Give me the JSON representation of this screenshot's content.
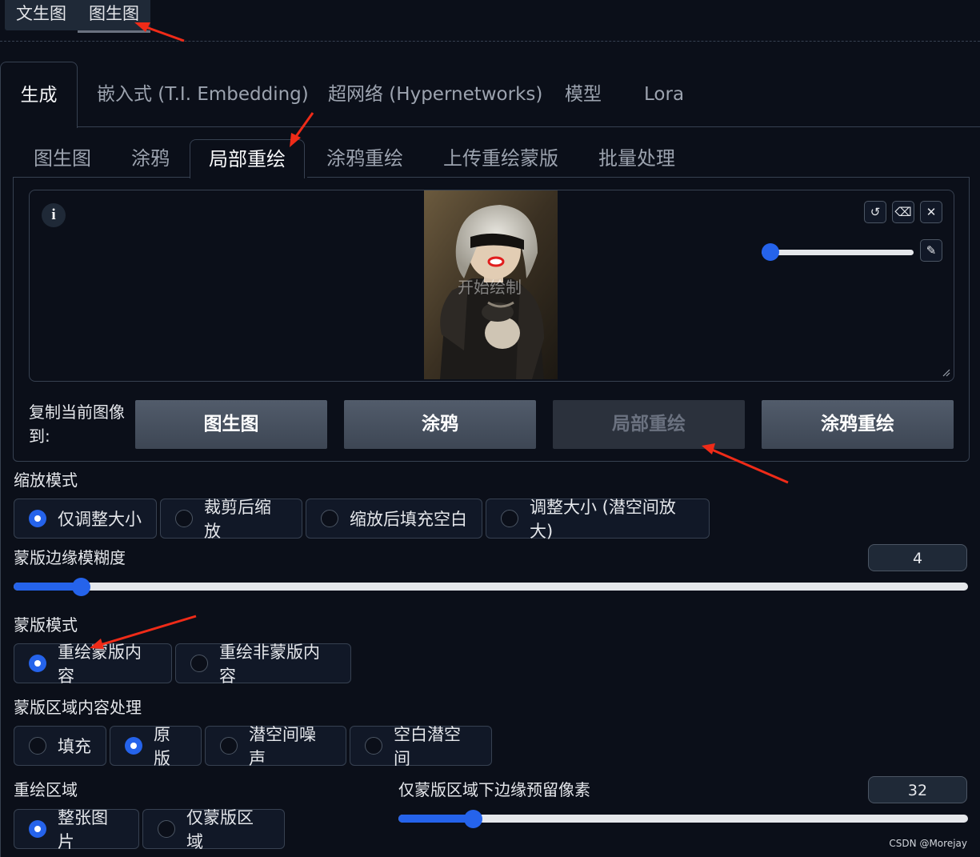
{
  "top_tabs": [
    "文生图",
    "图生图"
  ],
  "main_tabs": [
    "生成",
    "嵌入式 (T.I. Embedding)",
    "超网络 (Hypernetworks)",
    "模型",
    "Lora"
  ],
  "sub_tabs": [
    "图生图",
    "涂鸦",
    "局部重绘",
    "涂鸦重绘",
    "上传重绘蒙版",
    "批量处理"
  ],
  "canvas": {
    "info_glyph": "i",
    "overlay_text": "开始绘制"
  },
  "copy_to": {
    "label": "复制当前图像到:",
    "buttons": [
      "图生图",
      "涂鸦",
      "局部重绘",
      "涂鸦重绘"
    ]
  },
  "resize_mode": {
    "label": "缩放模式",
    "options": [
      "仅调整大小",
      "裁剪后缩放",
      "缩放后填充空白",
      "调整大小 (潜空间放大)"
    ],
    "selected": 0
  },
  "mask_blur": {
    "label": "蒙版边缘模糊度",
    "value": "4",
    "fraction": 0.07
  },
  "mask_mode": {
    "label": "蒙版模式",
    "options": [
      "重绘蒙版内容",
      "重绘非蒙版内容"
    ],
    "selected": 0
  },
  "masked_content": {
    "label": "蒙版区域内容处理",
    "options": [
      "填充",
      "原版",
      "潜空间噪声",
      "空白潜空间"
    ],
    "selected": 1
  },
  "inpaint_area": {
    "label": "重绘区域",
    "options": [
      "整张图片",
      "仅蒙版区域"
    ],
    "selected": 0
  },
  "padding": {
    "label": "仅蒙版区域下边缘预留像素",
    "value": "32",
    "fraction": 0.13
  },
  "watermark": "CSDN @Morejay",
  "colors": {
    "background": "#0b0f19",
    "accent": "#2563eb",
    "arrow": "#ef2b18"
  }
}
